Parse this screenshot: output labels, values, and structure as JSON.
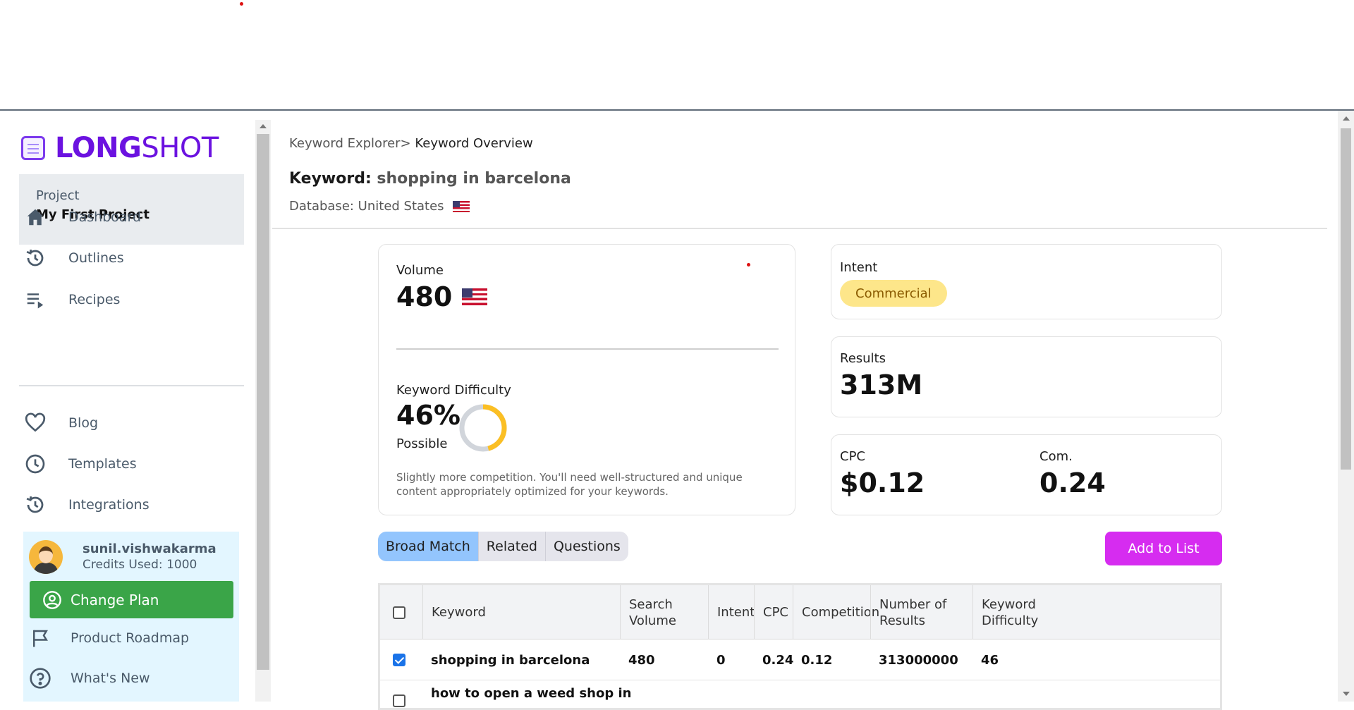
{
  "brand": {
    "logo_bold": "LONG",
    "logo_light": "SHOT",
    "accent": "#6b12e0"
  },
  "sidebar": {
    "project_label": "Project",
    "project_name": "My First Project",
    "nav": [
      {
        "label": "Dashboard",
        "icon": "home-icon"
      },
      {
        "label": "Outlines",
        "icon": "history-icon"
      },
      {
        "label": "Recipes",
        "icon": "playlist-icon"
      },
      {
        "label": "Blog",
        "icon": "heart-icon"
      },
      {
        "label": "Templates",
        "icon": "clock-icon"
      },
      {
        "label": "Integrations",
        "icon": "history-icon"
      }
    ],
    "user": {
      "name": "sunil.vishwakarma",
      "credits": "Credits Used: 1000",
      "change_plan": "Change Plan",
      "change_plan_color": "#3aa548"
    },
    "sub_nav": [
      {
        "label": "Product Roadmap",
        "icon": "flag-icon"
      },
      {
        "label": "What's New",
        "icon": "help-circle-icon"
      }
    ]
  },
  "main": {
    "breadcrumb_parent": "Keyword Explorer>",
    "breadcrumb_current": " Keyword Overview",
    "keyword_label": "Keyword:",
    "keyword_value": " shopping in barcelona",
    "database": "Database: United States",
    "volume_label": "Volume",
    "volume_value": "480",
    "kd_label": "Keyword Difficulty",
    "kd_value": "46%",
    "kd_percent": 46,
    "kd_status": "Possible",
    "kd_description": "Slightly more competition. You'll need well-structured and unique content appropriately optimized for your keywords.",
    "intent_label": "Intent",
    "intent_value": "Commercial",
    "results_label": "Results",
    "results_value": "313M",
    "cpc_label": "CPC",
    "cpc_value": "$0.12",
    "com_label": "Com.",
    "com_value": "0.24",
    "tabs": [
      "Broad Match",
      "Related",
      "Questions"
    ],
    "active_tab": "Broad Match",
    "add_to_list": "Add to List",
    "add_color": "#d62cf0"
  },
  "table": {
    "columns": [
      "Keyword",
      "Search Volume",
      "Intent",
      "CPC",
      "Competition",
      "Number of Results",
      "Keyword Difficulty"
    ],
    "rows": [
      {
        "checked": true,
        "cells": [
          "shopping in barcelona",
          "480",
          "0",
          "0.24",
          "0.12",
          "313000000",
          "46"
        ]
      },
      {
        "checked": false,
        "cells": [
          "how to open a weed shop in",
          "",
          "",
          "",
          "",
          "",
          ""
        ]
      }
    ]
  }
}
